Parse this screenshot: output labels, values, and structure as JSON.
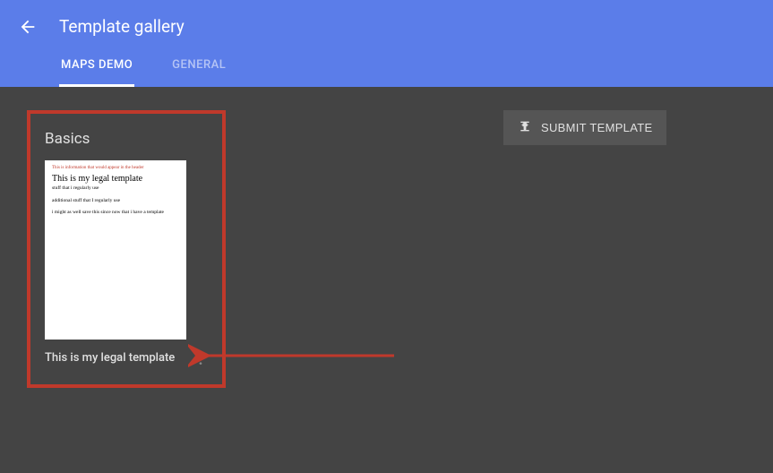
{
  "header": {
    "title": "Template gallery",
    "tabs": [
      {
        "label": "MAPS DEMO",
        "active": true
      },
      {
        "label": "GENERAL",
        "active": false
      }
    ]
  },
  "submit_button": {
    "label": "SUBMIT TEMPLATE"
  },
  "section": {
    "title": "Basics",
    "card": {
      "title": "This is my legal template",
      "thumb": {
        "red_header": "This is information that would appear in the header",
        "title": "This is my legal template",
        "para1": "stuff that i regularly use",
        "para2": "additional stuff that I regularly use",
        "para3": "i might as well save this since now that i have a template"
      }
    }
  }
}
